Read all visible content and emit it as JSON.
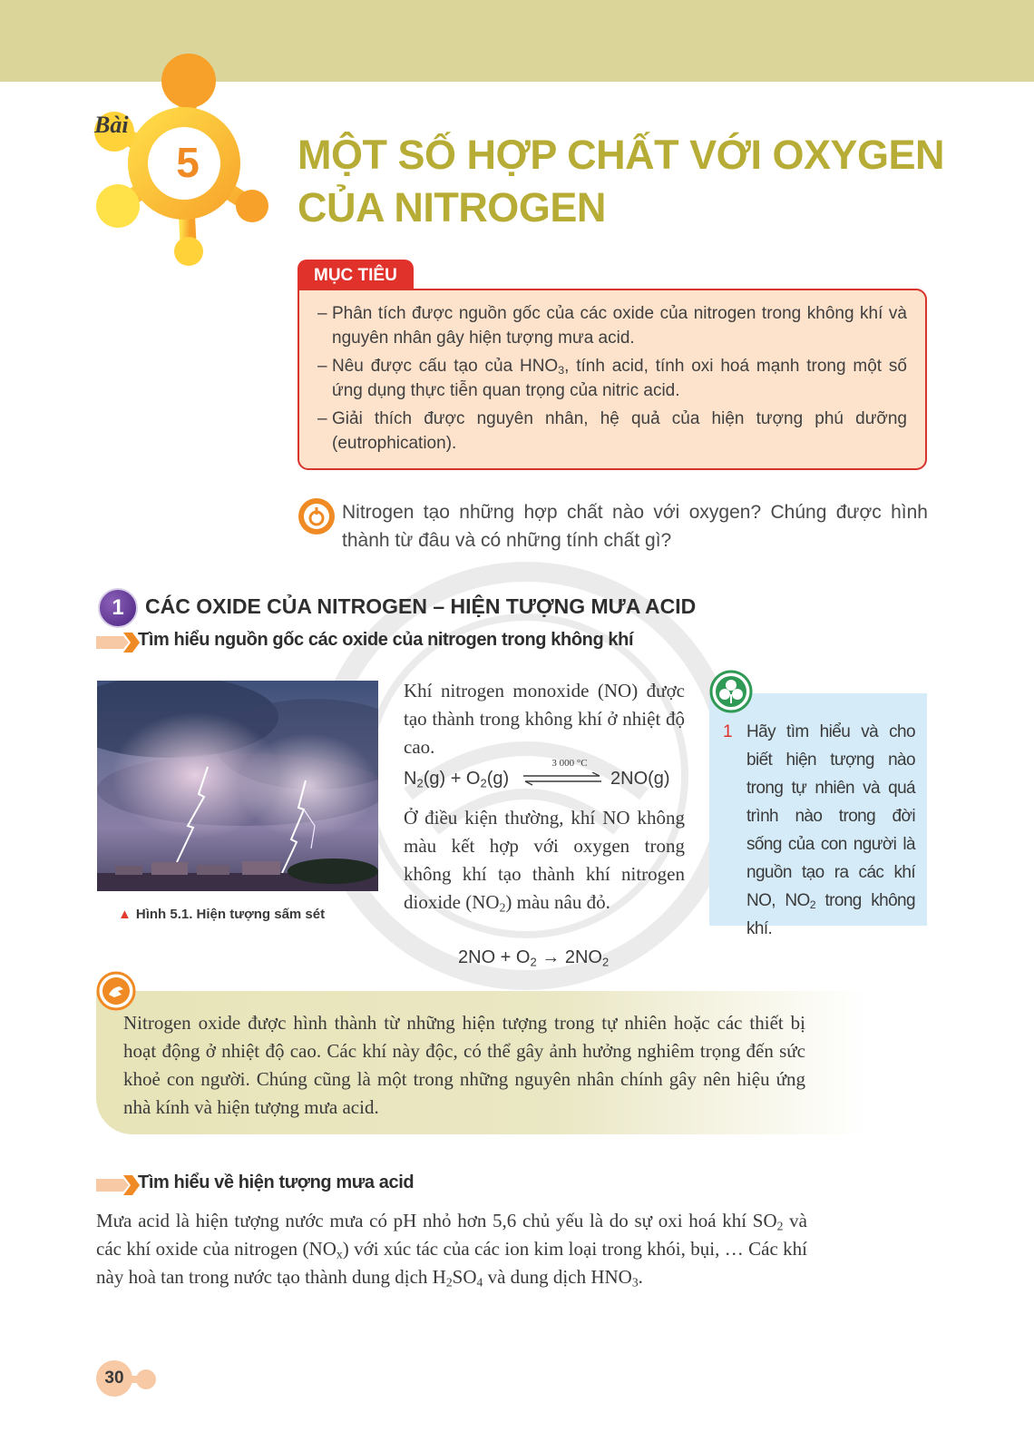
{
  "header": {
    "lesson_word": "Bài",
    "lesson_number": "5"
  },
  "title": {
    "line1": "MỘT SỐ HỢP CHẤT VỚI OXYGEN",
    "line2": "CỦA NITROGEN"
  },
  "objectives": {
    "label": "MỤC TIÊU",
    "items": [
      {
        "dash": "–",
        "text_a": "Phân tích được nguồn gốc của các oxide của nitrogen trong không khí và nguyên nhân gây hiện tượng mưa acid."
      },
      {
        "dash": "–",
        "text_a": "Nêu được cấu tạo của HNO",
        "sub": "3",
        "text_b": ", tính acid, tính oxi hoá mạnh trong một số ứng dụng thực tiễn quan trọng của nitric acid."
      },
      {
        "dash": "–",
        "text_a": "Giải thích được nguyên nhân, hệ quả của hiện tượng phú dưỡng (eutrophication)."
      }
    ]
  },
  "opening_question": "Nitrogen tạo những hợp chất nào với oxygen? Chúng được hình thành từ đâu và có những tính chất gì?",
  "section1": {
    "number": "1",
    "title": "CÁC OXIDE CỦA NITROGEN – HIỆN TƯỢNG MƯA ACID",
    "subsection1": "Tìm hiểu nguồn gốc các oxide của nitrogen trong không khí",
    "figure_caption": "Hình 5.1. Hiện tượng sấm sét",
    "text1": "Khí nitrogen monoxide (NO) được tạo thành trong không khí ở nhiệt độ cao.",
    "eq1": {
      "n": "N",
      "n_sub": "2",
      "g1": "(g) + O",
      "o_sub": "2",
      "g2": "(g)",
      "condition": "3 000 °C",
      "product": "2NO(g)"
    },
    "text2_a": "Ở điều kiện thường, khí NO không màu kết hợp với oxygen trong không khí tạo thành khí nitrogen dioxide (NO",
    "text2_sub": "2",
    "text2_b": ") màu nâu đỏ.",
    "eq2": {
      "a": "2NO + O",
      "a_sub": "2",
      "b": " → 2NO",
      "b_sub": "2"
    },
    "side_question": {
      "number": "1",
      "text_a": "Hãy tìm hiểu và cho biết hiện tượng nào trong tự nhiên và quá trình nào trong đời sống của con người là nguồn tạo ra các khí NO, NO",
      "sub": "2",
      "text_b": " trong không khí."
    },
    "note": "Nitrogen oxide được hình thành từ những hiện tượng trong tự nhiên hoặc các thiết bị hoạt động ở nhiệt độ cao. Các khí này độc, có thể gây ảnh hưởng nghiêm trọng đến sức khoẻ con người. Chúng cũng là một trong những nguyên nhân chính gây nên hiệu ứng nhà kính và hiện tượng mưa acid.",
    "subsection2": "Tìm hiểu về hiện tượng mưa acid",
    "rain": {
      "p1": "Mưa acid là hiện tượng nước mưa có pH nhỏ hơn 5,6 chủ yếu là do sự oxi hoá khí SO",
      "s1": "2",
      "p2": " và các khí oxide của nitrogen (NO",
      "s2": "x",
      "p3": ") với xúc tác của các ion kim loại trong khói, bụi, … Các khí này hoà tan trong nước tạo thành dung dịch H",
      "s3": "2",
      "p4": "SO",
      "s4": "4",
      "p5": " và dung dịch HNO",
      "s5": "3",
      "p6": "."
    }
  },
  "page_number": "30",
  "colors": {
    "title": "#b7ac36",
    "accent_red": "#e0312b",
    "accent_orange": "#f08a24",
    "band": "#dcd59a"
  }
}
